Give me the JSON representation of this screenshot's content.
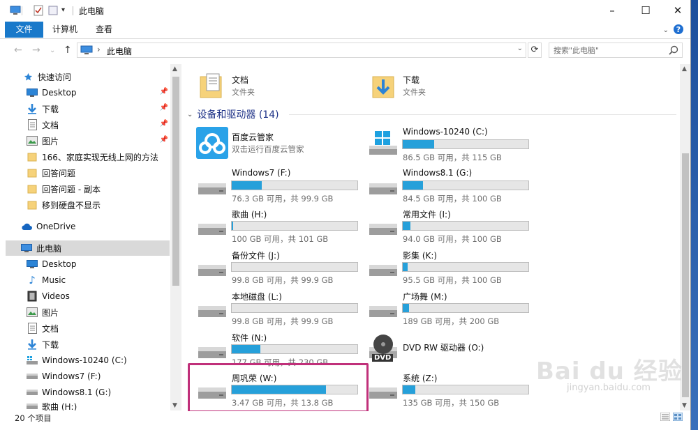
{
  "window": {
    "title": "此电脑",
    "minimize": "–",
    "maximize": "☐",
    "close": "✕"
  },
  "ribbon": {
    "tabs": [
      "文件",
      "计算机",
      "查看"
    ]
  },
  "address": {
    "crumb": "此电脑",
    "search_placeholder": "搜索\"此电脑\""
  },
  "nav": {
    "items": [
      {
        "label": "快速访问",
        "icon": "star-icon",
        "pinned": false
      },
      {
        "label": "Desktop",
        "icon": "desktop-icon",
        "pinned": true
      },
      {
        "label": "下载",
        "icon": "download-arrow-icon",
        "pinned": true
      },
      {
        "label": "文档",
        "icon": "document-icon",
        "pinned": true
      },
      {
        "label": "图片",
        "icon": "pictures-icon",
        "pinned": true
      },
      {
        "label": "166、家庭实现无线上网的方法",
        "icon": "folder-icon",
        "pinned": false
      },
      {
        "label": "回答问题",
        "icon": "folder-icon",
        "pinned": false
      },
      {
        "label": "回答问题 - 副本",
        "icon": "folder-icon",
        "pinned": false
      },
      {
        "label": "移到硬盘不显示",
        "icon": "folder-icon",
        "pinned": false
      },
      {
        "label": "OneDrive",
        "icon": "cloud-icon",
        "pinned": false
      },
      {
        "label": "此电脑",
        "icon": "computer-icon",
        "pinned": false
      },
      {
        "label": "Desktop",
        "icon": "desktop-icon",
        "pinned": false
      },
      {
        "label": "Music",
        "icon": "music-icon",
        "pinned": false
      },
      {
        "label": "Videos",
        "icon": "video-icon",
        "pinned": false
      },
      {
        "label": "图片",
        "icon": "pictures-icon",
        "pinned": false
      },
      {
        "label": "文档",
        "icon": "document-icon",
        "pinned": false
      },
      {
        "label": "下载",
        "icon": "download-arrow-icon",
        "pinned": false
      },
      {
        "label": "Windows-10240 (C:)",
        "icon": "windows-drive-icon",
        "pinned": false
      },
      {
        "label": "Windows7 (F:)",
        "icon": "drive-icon",
        "pinned": false
      },
      {
        "label": "Windows8.1 (G:)",
        "icon": "drive-icon",
        "pinned": false
      },
      {
        "label": "歌曲 (H:)",
        "icon": "drive-icon",
        "pinned": false
      }
    ]
  },
  "folders": [
    {
      "name": "文档",
      "sub": "文件夹"
    },
    {
      "name": "下载",
      "sub": "文件夹"
    }
  ],
  "group": {
    "title": "设备和驱动器 (14)"
  },
  "baidu_app": {
    "name": "百度云管家",
    "sub": "双击运行百度云管家"
  },
  "drives": [
    {
      "name": "Windows-10240 (C:)",
      "free": "86.5 GB 可用，共 115 GB",
      "used_fraction": 0.25,
      "icon": "windows-drive-icon"
    },
    {
      "name": "Windows7 (F:)",
      "free": "76.3 GB 可用，共 99.9 GB",
      "used_fraction": 0.24,
      "icon": "drive-icon"
    },
    {
      "name": "Windows8.1 (G:)",
      "free": "84.5 GB 可用，共 100 GB",
      "used_fraction": 0.16,
      "icon": "drive-icon"
    },
    {
      "name": "歌曲 (H:)",
      "free": "100 GB 可用，共 101 GB",
      "used_fraction": 0.01,
      "icon": "drive-icon"
    },
    {
      "name": "常用文件 (I:)",
      "free": "94.0 GB 可用，共 100 GB",
      "used_fraction": 0.06,
      "icon": "drive-icon"
    },
    {
      "name": "备份文件 (J:)",
      "free": "99.8 GB 可用，共 99.9 GB",
      "used_fraction": 0.0,
      "icon": "drive-icon"
    },
    {
      "name": "影集 (K:)",
      "free": "95.5 GB 可用，共 100 GB",
      "used_fraction": 0.04,
      "icon": "drive-icon"
    },
    {
      "name": "本地磁盘 (L:)",
      "free": "99.8 GB 可用，共 99.9 GB",
      "used_fraction": 0.0,
      "icon": "drive-icon"
    },
    {
      "name": "广场舞 (M:)",
      "free": "189 GB 可用，共 200 GB",
      "used_fraction": 0.05,
      "icon": "drive-icon"
    },
    {
      "name": "软件 (N:)",
      "free": "177 GB 可用，共 230 GB",
      "used_fraction": 0.23,
      "icon": "drive-icon"
    },
    {
      "name": "周巩荣 (W:)",
      "free": "3.47 GB 可用，共 13.8 GB",
      "used_fraction": 0.75,
      "icon": "drive-icon"
    },
    {
      "name": "系统 (Z:)",
      "free": "135 GB 可用，共 150 GB",
      "used_fraction": 0.1,
      "icon": "drive-icon"
    }
  ],
  "dvd": {
    "name": "DVD RW 驱动器 (O:)",
    "badge": "DVD"
  },
  "status": {
    "count": "20 个项目"
  },
  "watermark": {
    "brand": "Bai du 经验",
    "url": "jingyan.baidu.com"
  },
  "colors": {
    "accent": "#1979ca",
    "bar_fill": "#26a0da",
    "highlight": "#c0307a"
  }
}
